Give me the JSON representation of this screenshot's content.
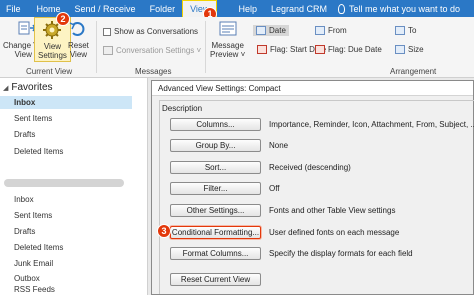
{
  "tabs": [
    "File",
    "Home",
    "Send / Receive",
    "Folder",
    "View",
    "Help",
    "Legrand CRM"
  ],
  "tell_me": "Tell me what you want to do",
  "badges": [
    "1",
    "2",
    "3"
  ],
  "ribbon": {
    "change_view": "Change View",
    "change_view_2": "View ˅",
    "view_settings": "View",
    "view_settings_2": "Settings",
    "reset_view": "Reset",
    "reset_view_2": "View",
    "current_view_group": "Current View",
    "show_conversations": "Show as Conversations",
    "conversation_settings": "Conversation Settings ˅",
    "messages_group": "Messages",
    "message_preview": "Message",
    "message_preview_2": "Preview ˅",
    "date": "Date",
    "from": "From",
    "to": "To",
    "flag_start": "Flag: Start Date",
    "flag_due": "Flag: Due Date",
    "size": "Size",
    "arrangement_group": "Arrangement"
  },
  "folders": {
    "favorites": "Favorites",
    "fav_items": [
      "Inbox",
      "Sent Items",
      "Drafts",
      "Deleted Items"
    ],
    "acct_items": [
      "Inbox",
      "Sent Items",
      "Drafts",
      "Deleted Items",
      "Junk Email",
      "Outbox",
      "RSS Feeds"
    ]
  },
  "dialog": {
    "title": "Advanced View Settings: Compact",
    "legend": "Description",
    "rows": [
      {
        "button": "Columns...",
        "desc": "Importance, Reminder, Icon, Attachment, From, Subject, ..."
      },
      {
        "button": "Group By...",
        "desc": "None"
      },
      {
        "button": "Sort...",
        "desc": "Received (descending)"
      },
      {
        "button": "Filter...",
        "desc": "Off"
      },
      {
        "button": "Other Settings...",
        "desc": "Fonts and other Table View settings"
      },
      {
        "button": "Conditional Formatting...",
        "desc": "User defined fonts on each message"
      },
      {
        "button": "Format Columns...",
        "desc": "Specify the display formats for each field"
      }
    ],
    "reset_button": "Reset Current View"
  },
  "colors": {
    "accent": "#2b78c6",
    "badge": "#e3380b",
    "selected": "#cde6f7"
  }
}
